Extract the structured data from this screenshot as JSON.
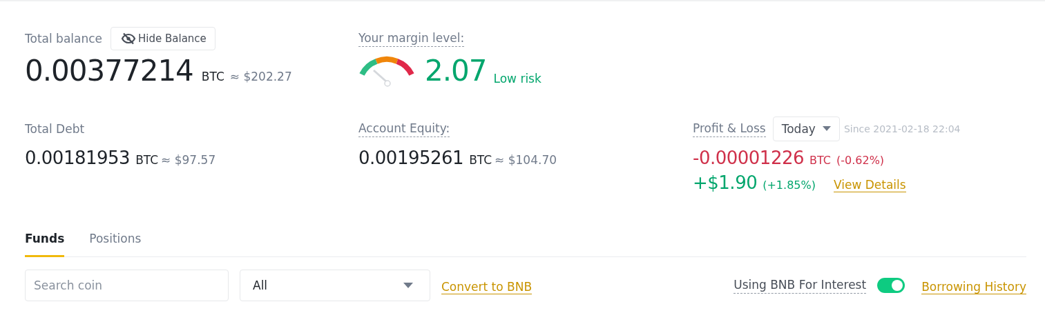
{
  "balance": {
    "label": "Total balance",
    "hide_button": "Hide Balance",
    "amount": "0.00377214",
    "unit": "BTC",
    "usd": "≈ $202.27"
  },
  "margin": {
    "label": "Your margin level:",
    "value": "2.07",
    "risk": "Low risk"
  },
  "debt": {
    "label": "Total Debt",
    "amount": "0.00181953",
    "unit": "BTC",
    "usd": "≈ $97.57"
  },
  "equity": {
    "label": "Account Equity:",
    "amount": "0.00195261",
    "unit": "BTC",
    "usd": "≈ $104.70"
  },
  "pnl": {
    "label": "Profit & Loss",
    "period": "Today",
    "since": "Since 2021-02-18 22:04",
    "btc_amount": "-0.00001226",
    "btc_unit": "BTC",
    "btc_pct": "(-0.62%)",
    "usd_amount": "+$1.90",
    "usd_pct": "(+1.85%)",
    "link": "View Details"
  },
  "tabs": [
    {
      "label": "Funds",
      "selected": true
    },
    {
      "label": "Positions",
      "selected": false
    }
  ],
  "search": {
    "placeholder": "Search coin"
  },
  "filter": {
    "value": "All"
  },
  "convert_link": "Convert to BNB",
  "bnb_interest": {
    "label": "Using BNB For Interest",
    "on": true
  },
  "history_link": "Borrowing History"
}
